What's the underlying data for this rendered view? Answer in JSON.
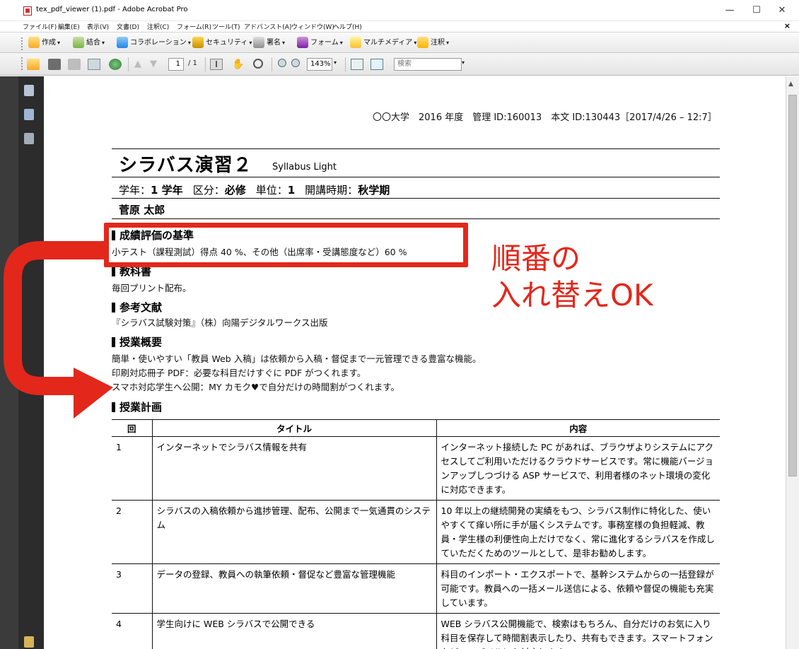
{
  "window": {
    "title": "tex_pdf_viewer (1).pdf - Adobe Acrobat Pro",
    "minimize": "—",
    "maximize": "☐",
    "close": "✕"
  },
  "menu": {
    "items": [
      "ファイル(F)",
      "編集(E)",
      "表示(V)",
      "文書(D)",
      "注釈(C)",
      "フォーム(R)",
      "ツール(T)",
      "アドバンスト(A)",
      "ウィンドウ(W)",
      "ヘルプ(H)"
    ],
    "close_doc": "×"
  },
  "toolbar": {
    "create": "作成",
    "combine": "結合",
    "collaboration": "コラボレーション",
    "security": "セキュリティ",
    "sign": "署名",
    "forms": "フォーム",
    "multimedia": "マルチメディア",
    "comment": "注釈",
    "page_current": "1",
    "page_total": "/ 1",
    "zoom": "143%",
    "search_placeholder": "検索"
  },
  "document": {
    "header_meta": "〇〇大学　2016 年度　管理 ID:160013　本文 ID:130443［2017/4/26 – 12:7］",
    "title": "シラバス演習２",
    "subtitle": "Syllabus Light",
    "meta": {
      "grade_label": "学年：",
      "grade": "1 学年",
      "category_label": "区分：",
      "category": "必修",
      "credit_label": "単位：",
      "credit": "1",
      "term_label": "開講時期：",
      "term": "秋学期"
    },
    "author": "菅原 太郎",
    "sections": {
      "grading": {
        "heading": "成績評価の基準",
        "body": "小テスト（課程測試）得点 40 %、その他（出席率・受講態度など）60 %"
      },
      "textbook": {
        "heading": "教科書",
        "body": "毎回プリント配布。"
      },
      "references": {
        "heading": "参考文献",
        "body": "『シラバス試験対策』（株）向陽デジタルワークス出版"
      },
      "overview": {
        "heading": "授業概要",
        "lines": [
          "簡単・使いやすい「教員 Web 入稿」は依頼から入稿・督促まで一元管理できる豊富な機能。",
          "印刷対応冊子 PDF：必要な科目だけすぐに PDF がつくれます。",
          "スマホ対応学生へ公開：MY カモク♥で自分だけの時間割がつくれます。"
        ]
      },
      "plan": {
        "heading": "授業計画"
      }
    },
    "table": {
      "headers": [
        "回",
        "タイトル",
        "内容"
      ],
      "rows": [
        {
          "no": "1",
          "title": "インターネットでシラバス情報を共有",
          "body": "インターネット接続した PC があれば、ブラウザよりシステムにアクセスしてご利用いただけるクラウドサービスです。常に機能バージョンアップしつづける ASP サービスで、利用者様のネット環境の変化に対応できます。"
        },
        {
          "no": "2",
          "title": "シラバスの入稿依頼から進捗管理、配布、公開まで一気通貫のシステム",
          "body": "10 年以上の継続開発の実績をもつ、シラバス制作に特化した、使いやすくて痒い所に手が届くシステムです。事務室様の負担軽減、教員・学生様の利便性向上だけでなく、常に進化するシラバスを作成していただくためのツールとして、是非お勧めします。"
        },
        {
          "no": "3",
          "title": "データの登録、教員への執筆依頼・督促など豊富な管理機能",
          "body": "科目のインポート・エクスポートで、基幹システムからの一括登録が可能です。教員への一括メール送信による、依頼や督促の機能も充実しています。"
        },
        {
          "no": "4",
          "title": "学生向けに WEB シラバスで公開できる",
          "body": "WEB シラバス公開機能で、検索はもちろん、自分だけのお気に入り科目を保存して時間割表示したり、共有もできます。スマートフォンなどのモバイルにも対応します。"
        }
      ]
    }
  },
  "annotation": {
    "line1": "順番の",
    "line2": "入れ替えOK",
    "color": "#e3271b"
  }
}
